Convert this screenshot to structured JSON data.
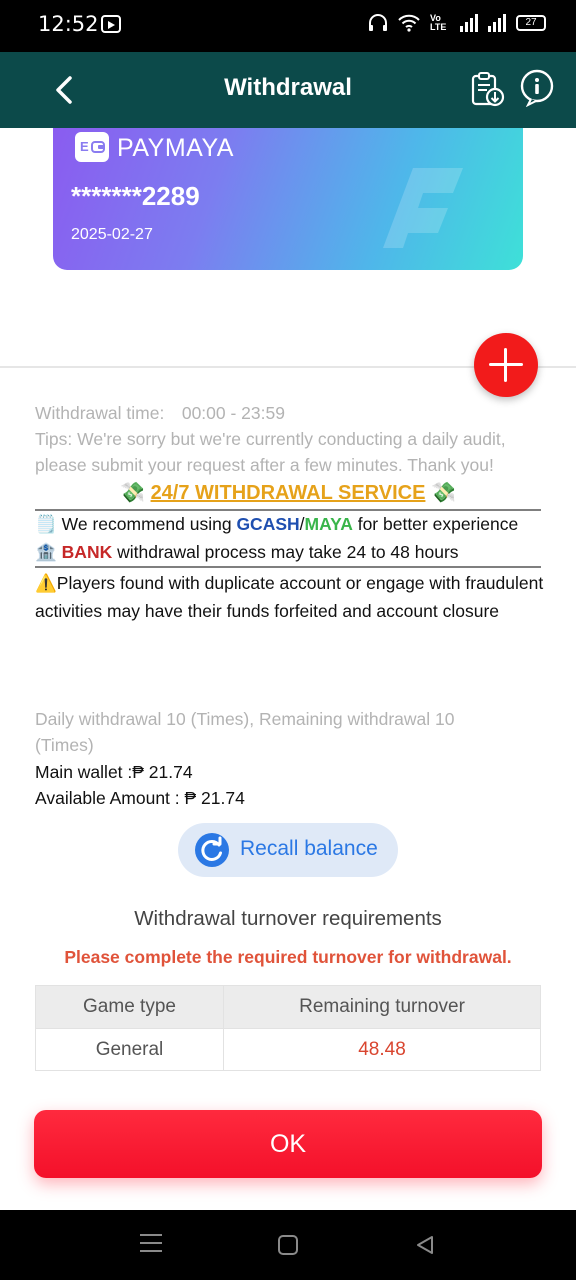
{
  "status_bar": {
    "time": "12:52",
    "network": "Vo LTE",
    "battery": "27"
  },
  "header": {
    "title": "Withdrawal",
    "icons": {
      "back": "back-arrow-icon",
      "records": "clipboard-download-icon",
      "help": "info-help-icon"
    }
  },
  "card": {
    "brand": "PAYMAYA",
    "logo_text": "E",
    "number": "*******2289",
    "date": "2025-02-27",
    "gradient": [
      "#8a5cf0",
      "#3ee0d8"
    ]
  },
  "add_account": {
    "icon": "plus-icon",
    "color": "#f21b1b"
  },
  "info": {
    "withdrawal_time": "Withdrawal time:　00:00 - 23:59",
    "tips": "Tips:  We're sorry but we're currently conducting a daily audit, please submit your request after a few minutes. Thank you!"
  },
  "service": {
    "emoji": "💸",
    "title": "24/7 WITHDRAWAL SERVICE",
    "line1": {
      "emoji": "🗒️",
      "prefix": "We recommend using ",
      "gcash": "GCASH",
      "slash": "/",
      "maya": "MAYA",
      "suffix": " for better experience"
    },
    "line2": {
      "emoji": "🏦",
      "bank": "BANK",
      "suffix": " withdrawal process may take 24 to 48 hours"
    },
    "warning": "⚠️Players found with duplicate account or engage with fraudulent activities may have their funds forfeited and account closure"
  },
  "wallet": {
    "daily": "Daily withdrawal 10 (Times), Remaining withdrawal 10 (Times)",
    "main_wallet": "Main wallet :₱ 21.74",
    "available": "Available Amount : ₱ 21.74"
  },
  "recall": {
    "label": "Recall balance",
    "icon": "refresh-icon"
  },
  "turnover": {
    "title": "Withdrawal turnover requirements",
    "warning": "Please complete the required turnover for withdrawal.",
    "columns": [
      "Game type",
      "Remaining turnover"
    ],
    "rows": [
      {
        "game_type": "General",
        "remaining": "48.48"
      }
    ]
  },
  "ok_button": {
    "label": "OK"
  }
}
